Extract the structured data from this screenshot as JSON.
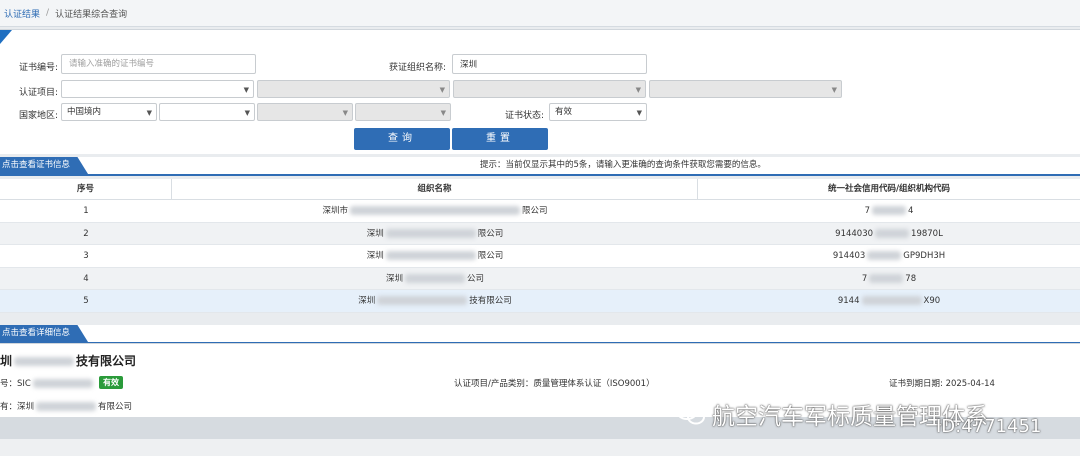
{
  "breadcrumb": {
    "root": "认证结果",
    "current": "认证结果综合查询"
  },
  "form": {
    "cert_no_label": "证书编号:",
    "cert_no_placeholder": "请输入准确的证书编号",
    "org_label": "获证组织名称:",
    "org_value": "深圳",
    "project_label": "认证项目:",
    "region_label": "国家地区:",
    "region_value": "中国境内",
    "status_label": "证书状态:",
    "status_value": "有效"
  },
  "buttons": {
    "query": "查询",
    "reset": "重置"
  },
  "results": {
    "tab_label": "点击查看证书信息",
    "hint": "提示：当前仅显示其中的5条，请输入更准确的查询条件获取您需要的信息。",
    "columns": [
      "序号",
      "组织名称",
      "统一社会信用代码/组织机构代码"
    ],
    "rows": [
      {
        "no": "1",
        "name_a": "深圳市",
        "name_b": "限公司",
        "code_a": "7",
        "code_b": "4"
      },
      {
        "no": "2",
        "name_a": "深圳",
        "name_b": "限公司",
        "code_a": "9144030",
        "code_b": "19870L"
      },
      {
        "no": "3",
        "name_a": "深圳",
        "name_b": "限公司",
        "code_a": "914403",
        "code_b": "GP9DH3H"
      },
      {
        "no": "4",
        "name_a": "深圳",
        "name_b": "公司",
        "code_a": "7",
        "code_b": "78"
      },
      {
        "no": "5",
        "name_a": "深圳",
        "name_b": "技有限公司",
        "code_a": "9144",
        "code_b": "X90"
      }
    ]
  },
  "detail": {
    "tab_label": "点击查看详细信息",
    "company_prefix": "圳",
    "company_suffix": "技有限公司",
    "cert_prefix": "号：SIC",
    "status_badge": "有效",
    "project": "认证项目/产品类别：质量管理体系认证（ISO9001）",
    "expiry": "证书到期日期: 2025-04-14",
    "holder_prefix": "有：深圳",
    "holder_suffix": "有限公司"
  },
  "watermark": {
    "text": "航空汽车军标质量管理体系",
    "id": "ID:4771451"
  }
}
